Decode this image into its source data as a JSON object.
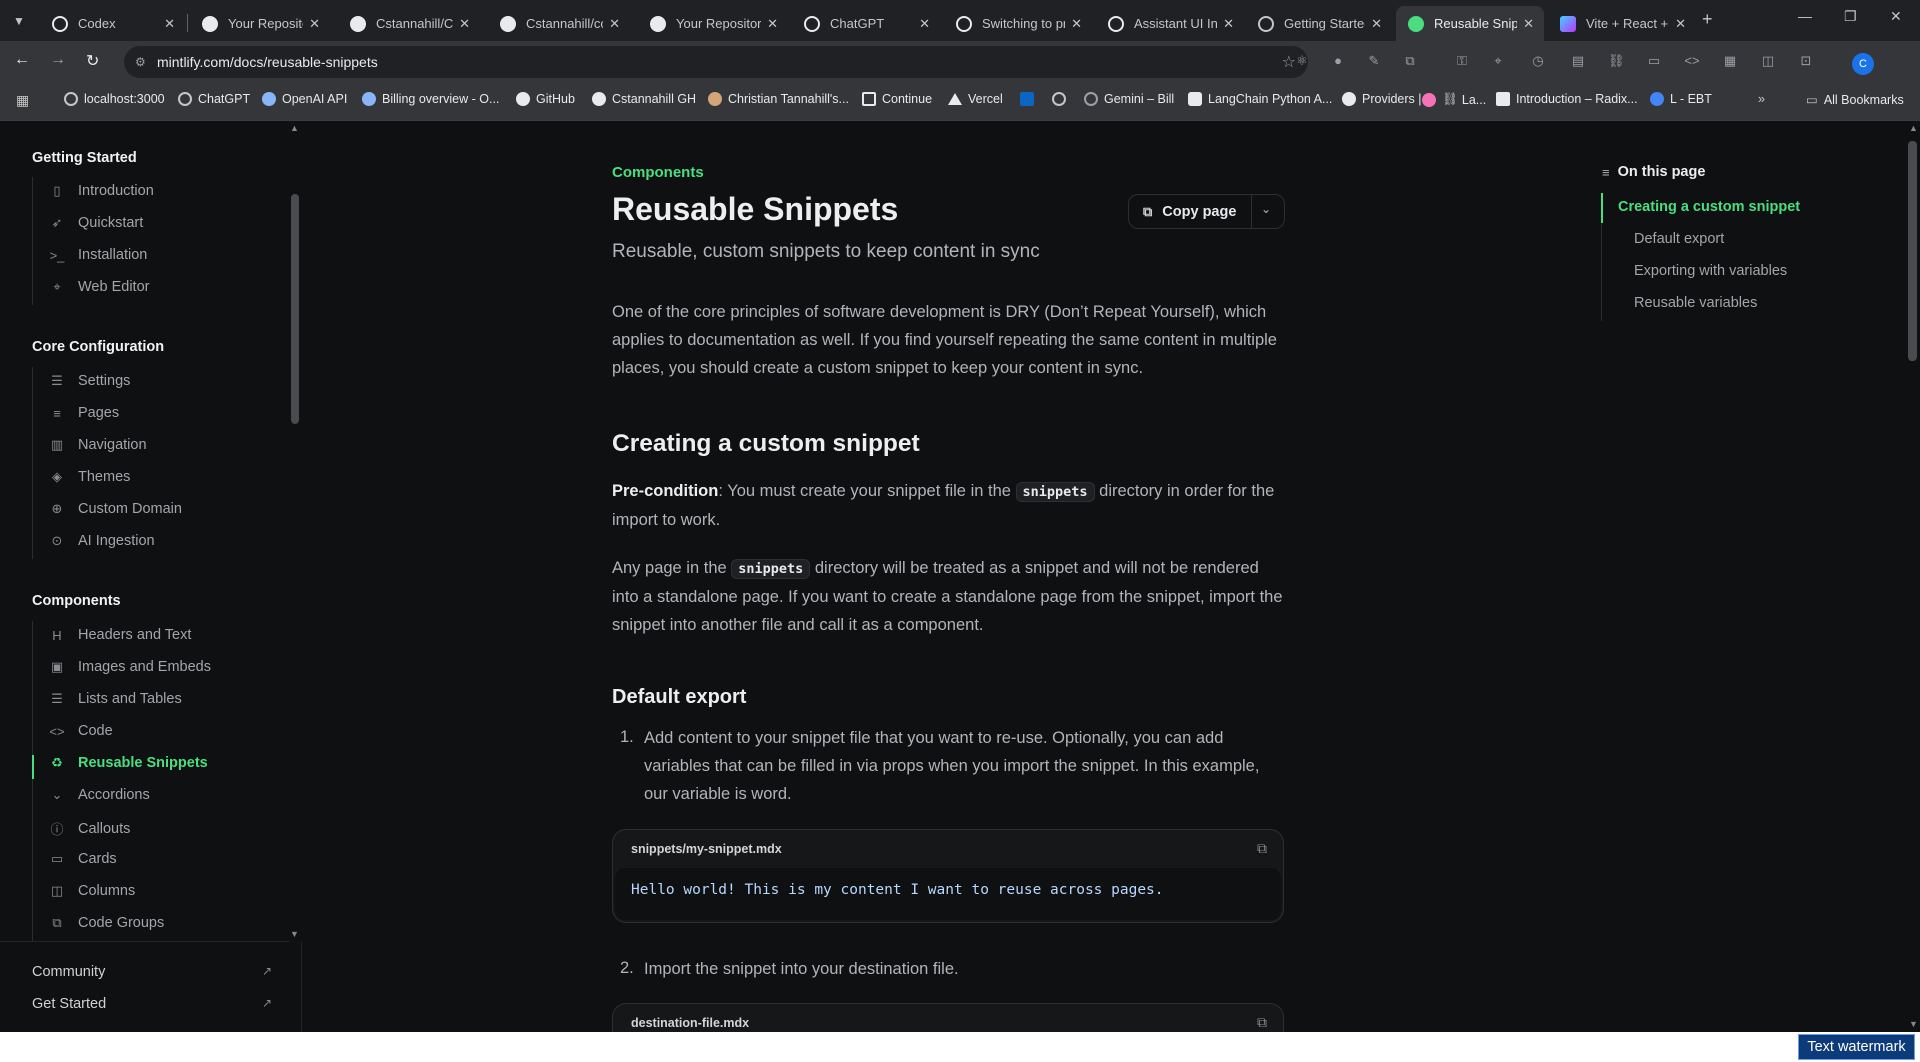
{
  "tabs": [
    {
      "title": "Codex",
      "favicon_color": "#e8eaed"
    },
    {
      "title": "Your Repositories",
      "favicon_color": "#e8eaed"
    },
    {
      "title": "Cstannahill/Co",
      "favicon_color": "#e8eaed"
    },
    {
      "title": "Cstannahill/co",
      "favicon_color": "#e8eaed"
    },
    {
      "title": "Your Repositories",
      "favicon_color": "#e8eaed"
    },
    {
      "title": "ChatGPT",
      "favicon_color": "#e8eaed"
    },
    {
      "title": "Switching to pr",
      "favicon_color": "#e8eaed"
    },
    {
      "title": "Assistant UI Int",
      "favicon_color": "#e8eaed"
    },
    {
      "title": "Getting Started",
      "favicon_color": "#e8eaed"
    },
    {
      "title": "Reusable Snippets",
      "favicon_color": "#4ade80",
      "active": true
    },
    {
      "title": "Vite + React +",
      "favicon_color": "#a78bfa"
    }
  ],
  "address": {
    "url": "mintlify.com/docs/reusable-snippets"
  },
  "profile": {
    "initial": "C"
  },
  "bookmarks": [
    {
      "label": "localhost:3000"
    },
    {
      "label": "ChatGPT"
    },
    {
      "label": "OpenAI API"
    },
    {
      "label": "Billing overview - O..."
    },
    {
      "label": "GitHub"
    },
    {
      "label": "Cstannahill GH"
    },
    {
      "label": "Christian Tannahill's..."
    },
    {
      "label": "Continue"
    },
    {
      "label": "Vercel"
    },
    {
      "label": "Gemini – Bill"
    },
    {
      "label": "LangChain Python A..."
    },
    {
      "label": "Providers |"
    },
    {
      "label": "La..."
    },
    {
      "label": "Introduction – Radix..."
    },
    {
      "label": "L - EBT"
    },
    {
      "label": "All Bookmarks"
    }
  ],
  "sidebar": {
    "groups": [
      {
        "title": "Getting Started",
        "items": [
          {
            "label": "Introduction",
            "icon": "book-open-icon"
          },
          {
            "label": "Quickstart",
            "icon": "rocket-icon"
          },
          {
            "label": "Installation",
            "icon": "terminal-icon"
          },
          {
            "label": "Web Editor",
            "icon": "cursor-icon"
          }
        ]
      },
      {
        "title": "Core Configuration",
        "items": [
          {
            "label": "Settings",
            "icon": "sliders-icon"
          },
          {
            "label": "Pages",
            "icon": "list-icon"
          },
          {
            "label": "Navigation",
            "icon": "map-icon"
          },
          {
            "label": "Themes",
            "icon": "palette-icon"
          },
          {
            "label": "Custom Domain",
            "icon": "globe-icon"
          },
          {
            "label": "AI Ingestion",
            "icon": "bot-icon"
          }
        ]
      },
      {
        "title": "Components",
        "items": [
          {
            "label": "Headers and Text",
            "icon": "heading-icon"
          },
          {
            "label": "Images and Embeds",
            "icon": "image-icon"
          },
          {
            "label": "Lists and Tables",
            "icon": "list-icon"
          },
          {
            "label": "Code",
            "icon": "code-icon"
          },
          {
            "label": "Reusable Snippets",
            "icon": "recycle-icon",
            "active": true
          },
          {
            "label": "Accordions",
            "icon": "chevron-down-icon"
          },
          {
            "label": "Callouts",
            "icon": "info-icon"
          },
          {
            "label": "Cards",
            "icon": "card-icon"
          },
          {
            "label": "Columns",
            "icon": "columns-icon"
          },
          {
            "label": "Code Groups",
            "icon": "code-group-icon"
          }
        ]
      }
    ],
    "footer": [
      {
        "label": "Community"
      },
      {
        "label": "Get Started"
      }
    ]
  },
  "main": {
    "eyebrow": "Components",
    "title": "Reusable Snippets",
    "subtitle": "Reusable, custom snippets to keep content in sync",
    "copy_label": "Copy page",
    "intro": "One of the core principles of software development is DRY (Don’t Repeat Yourself), which applies to documentation as well. If you find yourself repeating the same content in multiple places, you should create a custom snippet to keep your content in sync.",
    "h2_custom": "Creating a custom snippet",
    "precondition_label": "Pre-condition",
    "precondition_a": ": You must create your snippet file in the ",
    "precondition_code": "snippets",
    "precondition_b": " directory in order for the import to work.",
    "any_a": "Any page in the ",
    "any_code": "snippets",
    "any_b": " directory will be treated as a snippet and will not be rendered into a standalone page. If you want to create a standalone page from the snippet, import the snippet into another file and call it as a component.",
    "h3_default": "Default export",
    "step1_num": "1.",
    "step1": "Add content to your snippet file that you want to re-use. Optionally, you can add variables that can be filled in via props when you import the snippet. In this example, our variable is word.",
    "code1_file": "snippets/my-snippet.mdx",
    "code1_text": "Hello world! This is my content I want to reuse across pages.",
    "step2_num": "2.",
    "step2": "Import the snippet into your destination file.",
    "code2_file": "destination-file.mdx"
  },
  "toc": {
    "title": "On this page",
    "items": [
      {
        "label": "Creating a custom snippet",
        "active": true
      },
      {
        "label": "Default export"
      },
      {
        "label": "Exporting with variables"
      },
      {
        "label": "Reusable variables"
      }
    ]
  },
  "watermark": "Text watermark"
}
